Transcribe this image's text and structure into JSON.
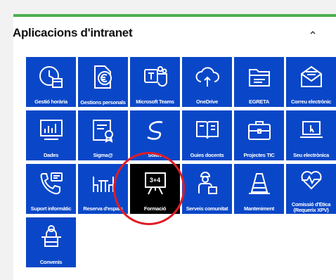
{
  "section": {
    "title": "Aplicacions d'intranet",
    "collapse_icon": "chevron-up-icon",
    "accent_color": "#4caf50",
    "tile_color": "#0a47c8",
    "active_tile_color": "#000000",
    "highlight_color": "#e21b24"
  },
  "tiles": [
    {
      "label": "Gestió horària",
      "icon": "clock-calendar-icon"
    },
    {
      "label": "Gestions personals",
      "icon": "euro-document-icon"
    },
    {
      "label": "Microsoft Teams",
      "icon": "teams-icon"
    },
    {
      "label": "OneDrive",
      "icon": "cloud-sync-icon"
    },
    {
      "label": "EGRETA",
      "icon": "folder-document-icon"
    },
    {
      "label": "Correu electrònic",
      "icon": "envelope-icon"
    },
    {
      "label": "Dades",
      "icon": "bar-chart-icon"
    },
    {
      "label": "Sigma@",
      "icon": "certificate-icon"
    },
    {
      "label": "Solwe",
      "icon": "swirl-logo-icon"
    },
    {
      "label": "Guies docents",
      "icon": "open-book-icon"
    },
    {
      "label": "Projectes TIC",
      "icon": "briefcase-icon"
    },
    {
      "label": "Seu electrònica",
      "icon": "laptop-cursor-icon"
    },
    {
      "label": "Suport informàtic",
      "icon": "phone-chat-icon"
    },
    {
      "label": "Reserva d'espais",
      "icon": "table-chairs-icon"
    },
    {
      "label": "Formació",
      "icon": "blackboard-icon"
    },
    {
      "label": "Serveis comunitat",
      "icon": "worker-box-icon"
    },
    {
      "label": "Manteniment",
      "icon": "traffic-cone-icon"
    },
    {
      "label": "Comissió d'Ètica (Requerix XPV)",
      "icon": "heart-pulse-icon"
    },
    {
      "label": "Convenis",
      "icon": "podium-person-icon"
    }
  ],
  "blackboard_text": "3+4"
}
